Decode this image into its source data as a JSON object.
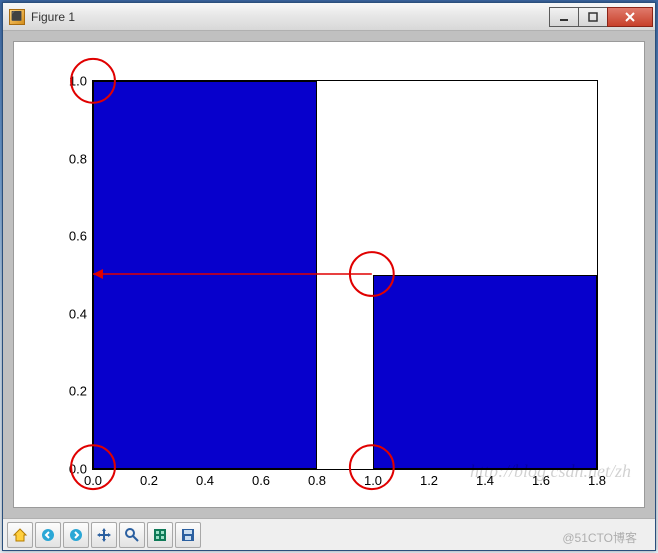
{
  "window": {
    "title": "Figure 1"
  },
  "toolbar": {
    "items": [
      "home",
      "back",
      "forward",
      "pan",
      "zoom",
      "subplots",
      "save"
    ]
  },
  "chart_data": {
    "type": "bar",
    "note": "Two filled axis-aligned rectangles (like plt.bar / patches) shown in data coordinates.",
    "rects": [
      {
        "x0": 0.0,
        "y0": 0.0,
        "x1": 0.8,
        "y1": 1.0,
        "color": "#0700cc"
      },
      {
        "x0": 1.0,
        "y0": 0.0,
        "x1": 1.8,
        "y1": 0.5,
        "color": "#0700cc"
      }
    ],
    "xlabel": "",
    "ylabel": "",
    "xlim": [
      0.0,
      1.8
    ],
    "ylim": [
      0.0,
      1.0
    ],
    "xticks": [
      0.0,
      0.2,
      0.4,
      0.6,
      0.8,
      1.0,
      1.2,
      1.4,
      1.6,
      1.8
    ],
    "yticks": [
      0.0,
      0.2,
      0.4,
      0.6,
      0.8,
      1.0
    ],
    "xtick_labels": [
      "0.0",
      "0.2",
      "0.4",
      "0.6",
      "0.8",
      "1.0",
      "1.2",
      "1.4",
      "1.6",
      "1.8"
    ],
    "ytick_labels": [
      "0.0",
      "0.2",
      "0.4",
      "0.6",
      "0.8",
      "1.0"
    ],
    "annotations": [
      {
        "kind": "circle",
        "at_data_xy": [
          0.0,
          1.0
        ]
      },
      {
        "kind": "circle",
        "at_data_xy": [
          0.0,
          0.0
        ]
      },
      {
        "kind": "circle",
        "at_data_xy": [
          1.0,
          0.0
        ]
      },
      {
        "kind": "circle",
        "at_data_xy": [
          1.0,
          0.5
        ]
      },
      {
        "kind": "arrow",
        "from_data_xy": [
          1.0,
          0.5
        ],
        "to_data_xy": [
          0.0,
          0.5
        ]
      }
    ]
  },
  "watermark": {
    "line1": "http://blog.csdn.net/zh",
    "line2": "@51CTO博客"
  }
}
